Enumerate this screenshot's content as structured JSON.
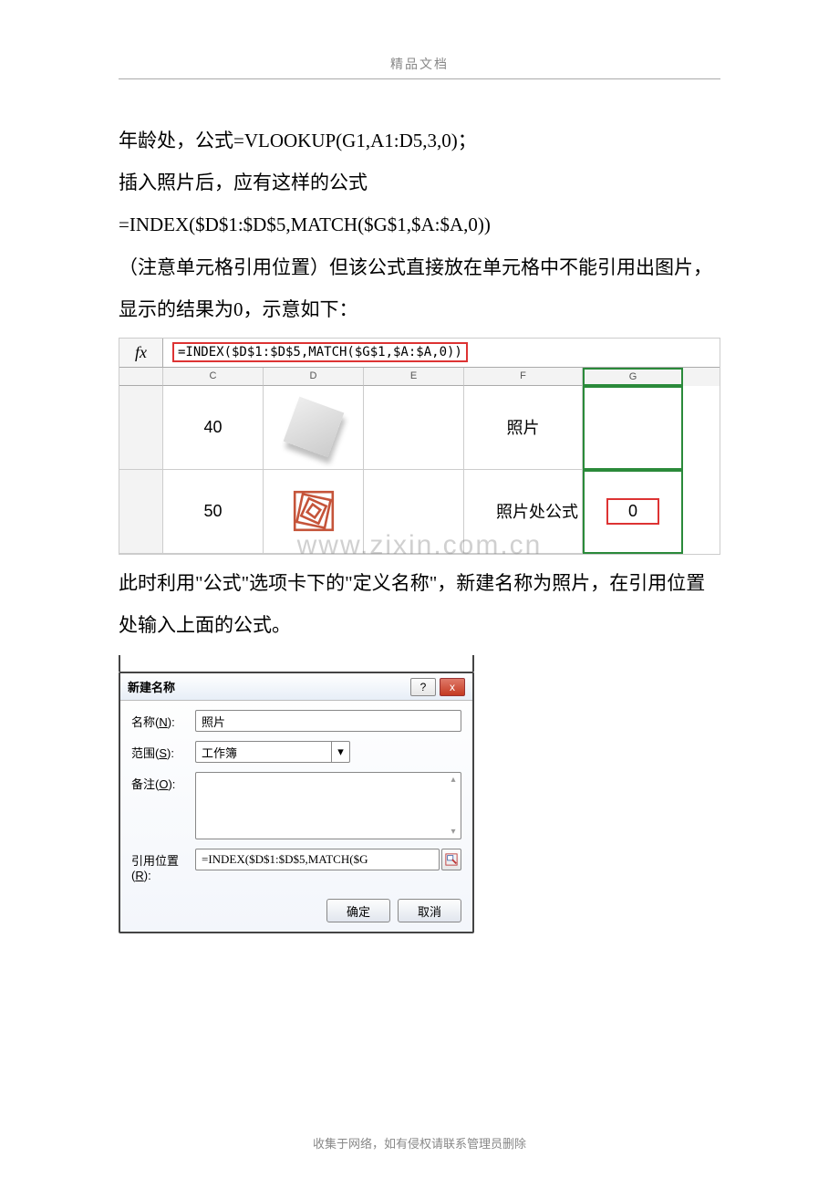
{
  "header": {
    "title": "精品文档"
  },
  "paragraphs": {
    "p1_a": "年龄处，公式",
    "p1_b": "=VLOOKUP(G1,A1:D5,3,0)",
    "p1_c": "；",
    "p2_a": "插入照片后，应有这样的公式",
    "p2_b": "=INDEX($D$1:$D$5,MATCH($G$1,$A:$A,0))",
    "p3": "（注意单元格引用位置）但该公式直接放在单元格中不能引用出图片，显示的结果为0，示意如下：",
    "p4": "此时利用\"公式\"选项卡下的\"定义名称\"，新建名称为照片，在引用位置处输入上面的公式。"
  },
  "excel": {
    "fx_label": "fx",
    "formula": "=INDEX($D$1:$D$5,MATCH($G$1,$A:$A,0))",
    "cols": {
      "c": "C",
      "d": "D",
      "e": "E",
      "f": "F",
      "g": "G"
    },
    "row1": {
      "c": "40",
      "f": "照片"
    },
    "row2": {
      "c": "50",
      "f": "照片处公式",
      "g": "0"
    },
    "watermark": "www.zixin.com.cn"
  },
  "dialog": {
    "title": "新建名称",
    "help": "?",
    "close": "x",
    "labels": {
      "name": "名称(N):",
      "scope": "范围(S):",
      "comment": "备注(O):",
      "refers": "引用位置(R):"
    },
    "values": {
      "name": "照片",
      "scope": "工作簿",
      "refers": "=INDEX($D$1:$D$5,MATCH($G"
    },
    "buttons": {
      "ok": "确定",
      "cancel": "取消"
    }
  },
  "footer": {
    "note": "收集于网络，如有侵权请联系管理员删除"
  }
}
